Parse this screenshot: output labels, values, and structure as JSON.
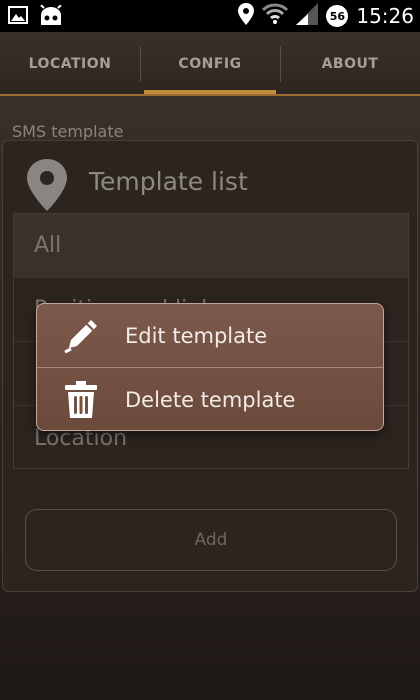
{
  "status_bar": {
    "time": "15:26",
    "battery_level": "56",
    "left_icons": [
      "image-icon",
      "cyanogenmod-android-icon"
    ],
    "right_icons": [
      "location-pin-icon",
      "wifi-icon",
      "signal-icon"
    ]
  },
  "tabs": [
    {
      "label": "LOCATION",
      "active": false
    },
    {
      "label": "CONFIG",
      "active": true
    },
    {
      "label": "ABOUT",
      "active": false
    }
  ],
  "page": {
    "section_label": "SMS template"
  },
  "dialog": {
    "title": "Template list",
    "icon": "map-pin-icon",
    "items": [
      {
        "label": "All",
        "selected": true
      },
      {
        "label": "Position and link",
        "selected": false
      },
      {
        "label": "",
        "selected": false
      },
      {
        "label": "Location",
        "selected": false
      }
    ],
    "add_button": "Add"
  },
  "context_menu": {
    "items": [
      {
        "label": "Edit template",
        "icon": "pencil-icon"
      },
      {
        "label": "Delete template",
        "icon": "trash-icon"
      }
    ]
  },
  "colors": {
    "accent": "#c28a3a",
    "menu_background": "#74523f",
    "background": "#2c241f"
  }
}
